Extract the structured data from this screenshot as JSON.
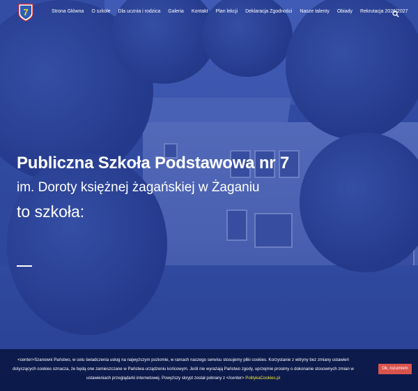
{
  "nav": {
    "items": [
      {
        "label": "Strona Główna"
      },
      {
        "label": "O szkole"
      },
      {
        "label": "Dla ucznia i rodzica"
      },
      {
        "label": "Galeria"
      },
      {
        "label": "Kontakt"
      },
      {
        "label": "Plan lekcji"
      },
      {
        "label": "Deklaracja Zgodności"
      },
      {
        "label": "Nasze talenty"
      },
      {
        "label": "Obiady"
      },
      {
        "label": "Rekrutacja 2026/2027"
      }
    ],
    "search_icon": "search-icon",
    "logo_icon": "school-logo-7"
  },
  "hero": {
    "title": "Publiczna Szkoła Podstawowa nr 7",
    "subtitle": "im. Doroty księżnej żagańskiej w Żaganiu",
    "lead": "to szkoła:"
  },
  "cookie": {
    "text_before_link": "<center>Szanowni Państwo, w celu świadczenia usług na najwyższym poziomie, w ramach naszego serwisu stosujemy pliki cookies. Korzystanie z witryny bez zmiany ustawień dotyczących cookies oznacza, że będą one zamieszczane w Państwa urządzeniu końcowym. Jeśli nie wyrażają Państwo zgody, uprzejmie prosimy o dokonanie stosownych zmian w ustawieniach przeglądarki internetowej. Powyższy skrypt został pobrany z </center>",
    "link_text": "PolitykaCookies.pl",
    "accept_label": "Ok, rozumiem"
  },
  "colors": {
    "overlay": "#2840a0",
    "cookie_bg": "#0a1846",
    "cookie_link": "#f4ea3a",
    "accept_button": "#d9534f"
  }
}
